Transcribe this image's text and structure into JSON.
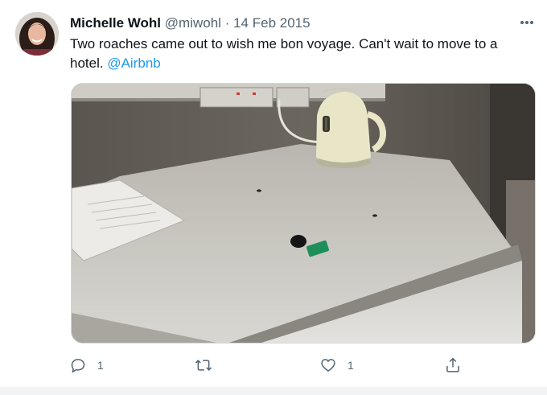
{
  "tweet": {
    "author_name": "Michelle Wohl",
    "handle": "@miwohl",
    "separator": "·",
    "date": "14 Feb 2015",
    "text": "Two roaches came out to wish me bon voyage. Can't wait to move to a hotel.",
    "mention": "@Airbnb",
    "media_alt": "Photo of a white counter top with a white kettle, papers and a key with a green tag"
  },
  "actions": {
    "reply": {
      "icon": "reply-icon",
      "count": "1"
    },
    "retweet": {
      "icon": "retweet-icon",
      "count": ""
    },
    "like": {
      "icon": "heart-icon",
      "count": "1"
    },
    "share": {
      "icon": "share-icon",
      "count": ""
    }
  },
  "colors": {
    "text": "#0f1419",
    "secondary": "#536471",
    "link": "#1d9bf0",
    "border": "#cfd9de"
  }
}
